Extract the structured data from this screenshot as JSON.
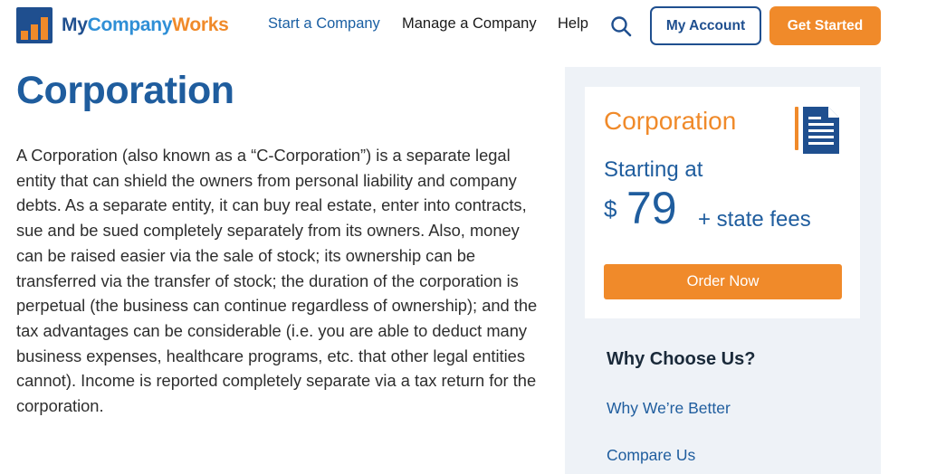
{
  "brand": {
    "name_part1": "My",
    "name_part2": "Company",
    "name_part3": "Works",
    "colors": {
      "navy": "#1f4f8f",
      "blue": "#2f8fd6",
      "orange": "#f08a2a"
    }
  },
  "nav": {
    "items": [
      {
        "label": "Start a Company"
      },
      {
        "label": "Manage a Company"
      },
      {
        "label": "Help"
      }
    ],
    "search_icon": "search-icon",
    "account_label": "My Account",
    "get_started_label": "Get Started"
  },
  "main": {
    "title": "Corporation",
    "description": "A Corporation (also known as a “C-Corporation”) is a separate legal entity that can shield the owners from personal liability and company debts. As a separate entity, it can buy real estate, enter into contracts, sue and be sued completely separately from its owners. Also, money can be raised easier via the sale of stock; its ownership can be transferred via the transfer of stock; the duration of the corporation is perpetual (the business can continue regardless of ownership); and the tax advantages can be considerable (i.e. you are able to deduct many business expenses, healthcare programs, etc. that other legal entities cannot). Income is reported completely separate via a tax return for the corporation."
  },
  "sidebar": {
    "card": {
      "title": "Corporation",
      "icon": "document-icon",
      "starting_label": "Starting at",
      "currency": "$",
      "price": "79",
      "fees": "+ state fees",
      "order_label": "Order Now"
    },
    "why_heading": "Why Choose Us?",
    "links": [
      {
        "label": "Why We’re Better"
      },
      {
        "label": "Compare Us"
      }
    ]
  }
}
